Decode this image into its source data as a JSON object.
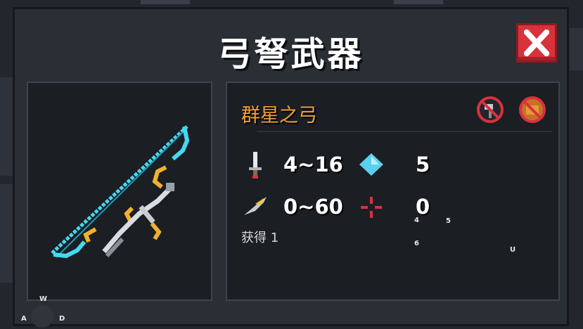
{
  "dialog": {
    "title": "弓弩武器",
    "close_icon": "close-x-icon"
  },
  "weapon": {
    "name": "群星之弓",
    "image_icon": "star-bow-icon",
    "badges": [
      "no-hammer-badge-icon",
      "no-chest-badge-icon"
    ],
    "stats": {
      "damage": "4~16",
      "energy": "5",
      "crit": "0~60",
      "spread": "0"
    },
    "obtained": "获得 1"
  },
  "key_hints": {
    "k4": "4",
    "k5": "5",
    "k6": "6",
    "ku": "U",
    "kw": "W",
    "ka": "A",
    "kd": "D"
  },
  "colors": {
    "title": "#ffffff",
    "weapon_name": "#f0a034",
    "close_button": "#d8323c",
    "bow_string": "#46d8f0"
  }
}
